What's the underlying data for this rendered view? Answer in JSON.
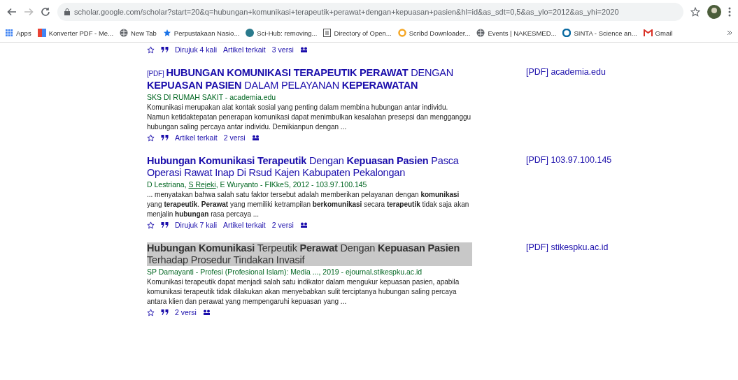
{
  "browser": {
    "url": "scholar.google.com/scholar?start=20&q=hubungan+komunikasi+terapeutik+perawat+dengan+kepuasan+pasien&hl=id&as_sdt=0,5&as_ylo=2012&as_yhi=2020"
  },
  "bookmarks": [
    {
      "label": "Apps",
      "kind": "apps"
    },
    {
      "label": "Konverter PDF - Me...",
      "kind": "pdf"
    },
    {
      "label": "New Tab",
      "kind": "globe"
    },
    {
      "label": "Perpustakaan Nasio...",
      "kind": "star"
    },
    {
      "label": "Sci-Hub: removing...",
      "kind": "scihub"
    },
    {
      "label": "Directory of Open...",
      "kind": "doc"
    },
    {
      "label": "Scribd Downloader...",
      "kind": "scribd"
    },
    {
      "label": "Events | NAKESMED...",
      "kind": "globe"
    },
    {
      "label": "SINTA - Science an...",
      "kind": "sinta"
    },
    {
      "label": "Gmail",
      "kind": "gmail"
    }
  ],
  "top_footer": [
    "Dirujuk 4 kali",
    "Artikel terkait",
    "3 versi"
  ],
  "results": [
    {
      "tag": "[PDF]",
      "title": "**HUBUNGAN KOMUNIKASI TERAPEUTIK PERAWAT** DENGAN **KEPUASAN PASIEN** DALAM PELAYANAN **KEPERAWATAN**",
      "highlighted": false,
      "authors": [
        {
          "text": "SKS DI RUMAH SAKIT - academia.edu",
          "link": false
        }
      ],
      "snippet": "Komunikasi merupakan alat kontak sosial yang penting dalam membina hubungan antar individu. Namun ketidaktepatan penerapan komunikasi dapat menimbulkan kesalahan presepsi dan mengganggu hubungan saling percaya antar individu. Demikianpun dengan ...",
      "footer": [
        "Artikel terkait",
        "2 versi"
      ],
      "pdf": "[PDF] academia.edu"
    },
    {
      "title": "**Hubungan Komunikasi Terapeutik** Dengan **Kepuasan Pasien** Pasca Operasi Rawat Inap Di Rsud Kajen Kabupaten Pekalongan",
      "highlighted": false,
      "authors": [
        {
          "text": "D Lestriana, ",
          "link": false
        },
        {
          "text": "S Rejeki",
          "link": true
        },
        {
          "text": ", E Wuryanto - FIKkeS, 2012 - 103.97.100.145",
          "link": false
        }
      ],
      "snippet": "... menyatakan bahwa salah satu faktor tersebut adalah memberikan pelayanan dengan **komunikasi** yang **terapeutik**. **Perawat** yang memiliki ketrampilan **berkomunikasi** secara **terapeutik** tidak saja akan menjalin **hubungan** rasa percaya ...",
      "footer": [
        "Dirujuk 7 kali",
        "Artikel terkait",
        "2 versi"
      ],
      "pdf": "[PDF] 103.97.100.145"
    },
    {
      "title": "**Hubungan Komunikasi** Terpeutik **Perawat** Dengan **Kepuasan Pasien** Terhadap Prosedur Tindakan Invasif",
      "highlighted": true,
      "authors": [
        {
          "text": "SP Damayanti - Profesi (Profesional Islam): Media ..., 2019 - ejournal.stikespku.ac.id",
          "link": false
        }
      ],
      "snippet": "Komunikasi terapeutik dapat menjadi salah satu indikator dalam mengukur kepuasan pasien, apabila komunikasi terapeutik tidak dilakukan akan menyebabkan sulit terciptanya hubungan saling percaya antara klien dan perawat yang mempengaruhi kepuasan yang ...",
      "footer": [
        "2 versi"
      ],
      "pdf": "[PDF] stikespku.ac.id"
    }
  ]
}
